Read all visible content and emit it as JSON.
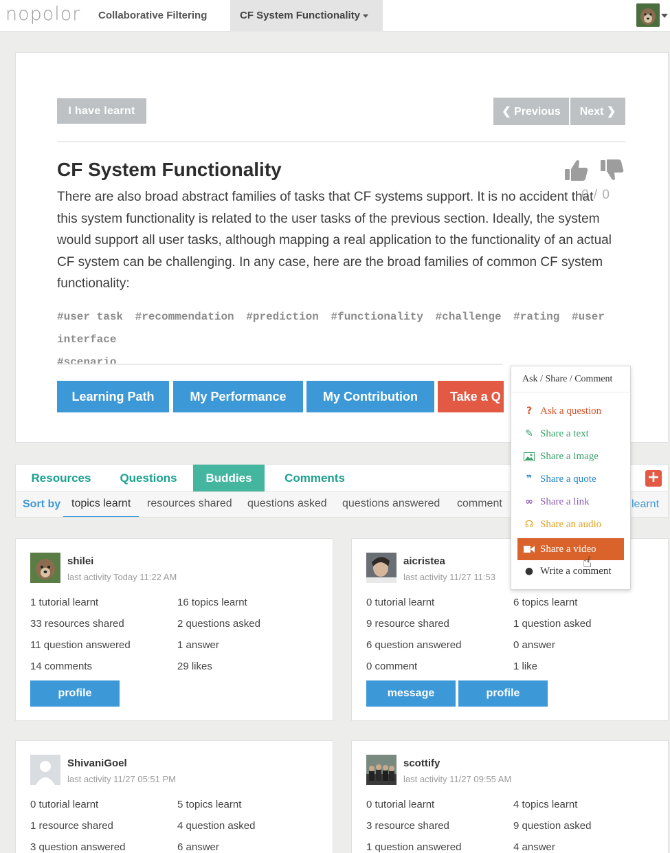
{
  "nav": {
    "logo": "nopolor",
    "items": [
      "Collaborative Filtering",
      "CF System Functionality"
    ]
  },
  "card": {
    "learnt_button": "I have learnt",
    "prev_button": "Previous",
    "next_button": "Next",
    "title": "CF System Functionality",
    "votes": "0 / 0",
    "description": "There are also broad abstract families of tasks that CF systems support. It is no accident that this system functionality is related to the user tasks of the previous section. Ideally, the system would support all user tasks, although mapping a real application to the functionality of an actual CF system can be challenging. In any case, here are the broad families of common CF system functionality:",
    "tags": [
      "#user task",
      "#recommendation",
      "#prediction",
      "#functionality",
      "#challenge",
      "#rating",
      "#user interface",
      "#scenario"
    ],
    "actions": [
      "Learning Path",
      "My Performance",
      "My Contribution",
      "Take a Q"
    ]
  },
  "popover": {
    "header": "Ask / Share / Comment",
    "items": [
      {
        "label": "Ask a question",
        "icon": "question-icon",
        "color": "#d9532c"
      },
      {
        "label": "Share a text",
        "icon": "pencil-icon",
        "color": "#38a169"
      },
      {
        "label": "Share a image",
        "icon": "image-icon",
        "color": "#38a169"
      },
      {
        "label": "Share a quote",
        "icon": "quote-icon",
        "color": "#2a87c8"
      },
      {
        "label": "Share a link",
        "icon": "link-icon",
        "color": "#8b5bb5"
      },
      {
        "label": "Share an audio",
        "icon": "headphones-icon",
        "color": "#e2a020"
      },
      {
        "label": "Share a video",
        "icon": "video-icon",
        "color": "#ffffff"
      },
      {
        "label": "Write a comment",
        "icon": "comment-icon",
        "color": "#333333"
      }
    ]
  },
  "tabs": [
    "Resources",
    "Questions",
    "Buddies",
    "Comments"
  ],
  "sort": {
    "label": "Sort by",
    "options": [
      "topics learnt",
      "resources shared",
      "questions asked",
      "questions answered",
      "comment"
    ],
    "tail": "learnt"
  },
  "buddies": [
    {
      "name": "shilei",
      "activity": "last activity Today 11:22 AM",
      "stats": [
        "1 tutorial learnt",
        "16 topics learnt",
        "33 resources shared",
        "2 questions asked",
        "11 question answered",
        "1 answer",
        "14 comments",
        "29 likes"
      ],
      "buttons": [
        "profile"
      ]
    },
    {
      "name": "aicristea",
      "activity": "last activity 11/27 11:53",
      "stats": [
        "0 tutorial learnt",
        "6 topics learnt",
        "9 resource shared",
        "1 question asked",
        "6 question answered",
        "0 answer",
        "0 comment",
        "1 like"
      ],
      "buttons": [
        "message",
        "profile"
      ]
    },
    {
      "name": "ShivaniGoel",
      "activity": "last activity 11/27 05:51 PM",
      "stats": [
        "0 tutorial learnt",
        "5 topics learnt",
        "1 resource shared",
        "4 question asked",
        "3 question answered",
        "6 answer"
      ],
      "buttons": []
    },
    {
      "name": "scottify",
      "activity": "last activity 11/27 09:55 AM",
      "stats": [
        "0 tutorial learnt",
        "4 topics learnt",
        "3 resource shared",
        "9 question asked",
        "1 question answered",
        "4 answer"
      ],
      "buttons": []
    }
  ],
  "colors": {
    "primary": "#3d98d8",
    "danger": "#e35a44",
    "teal": "#1aa18f",
    "tab_active": "#44b59f",
    "disabled": "#bdc1c4",
    "popover_active": "#d9632b"
  }
}
